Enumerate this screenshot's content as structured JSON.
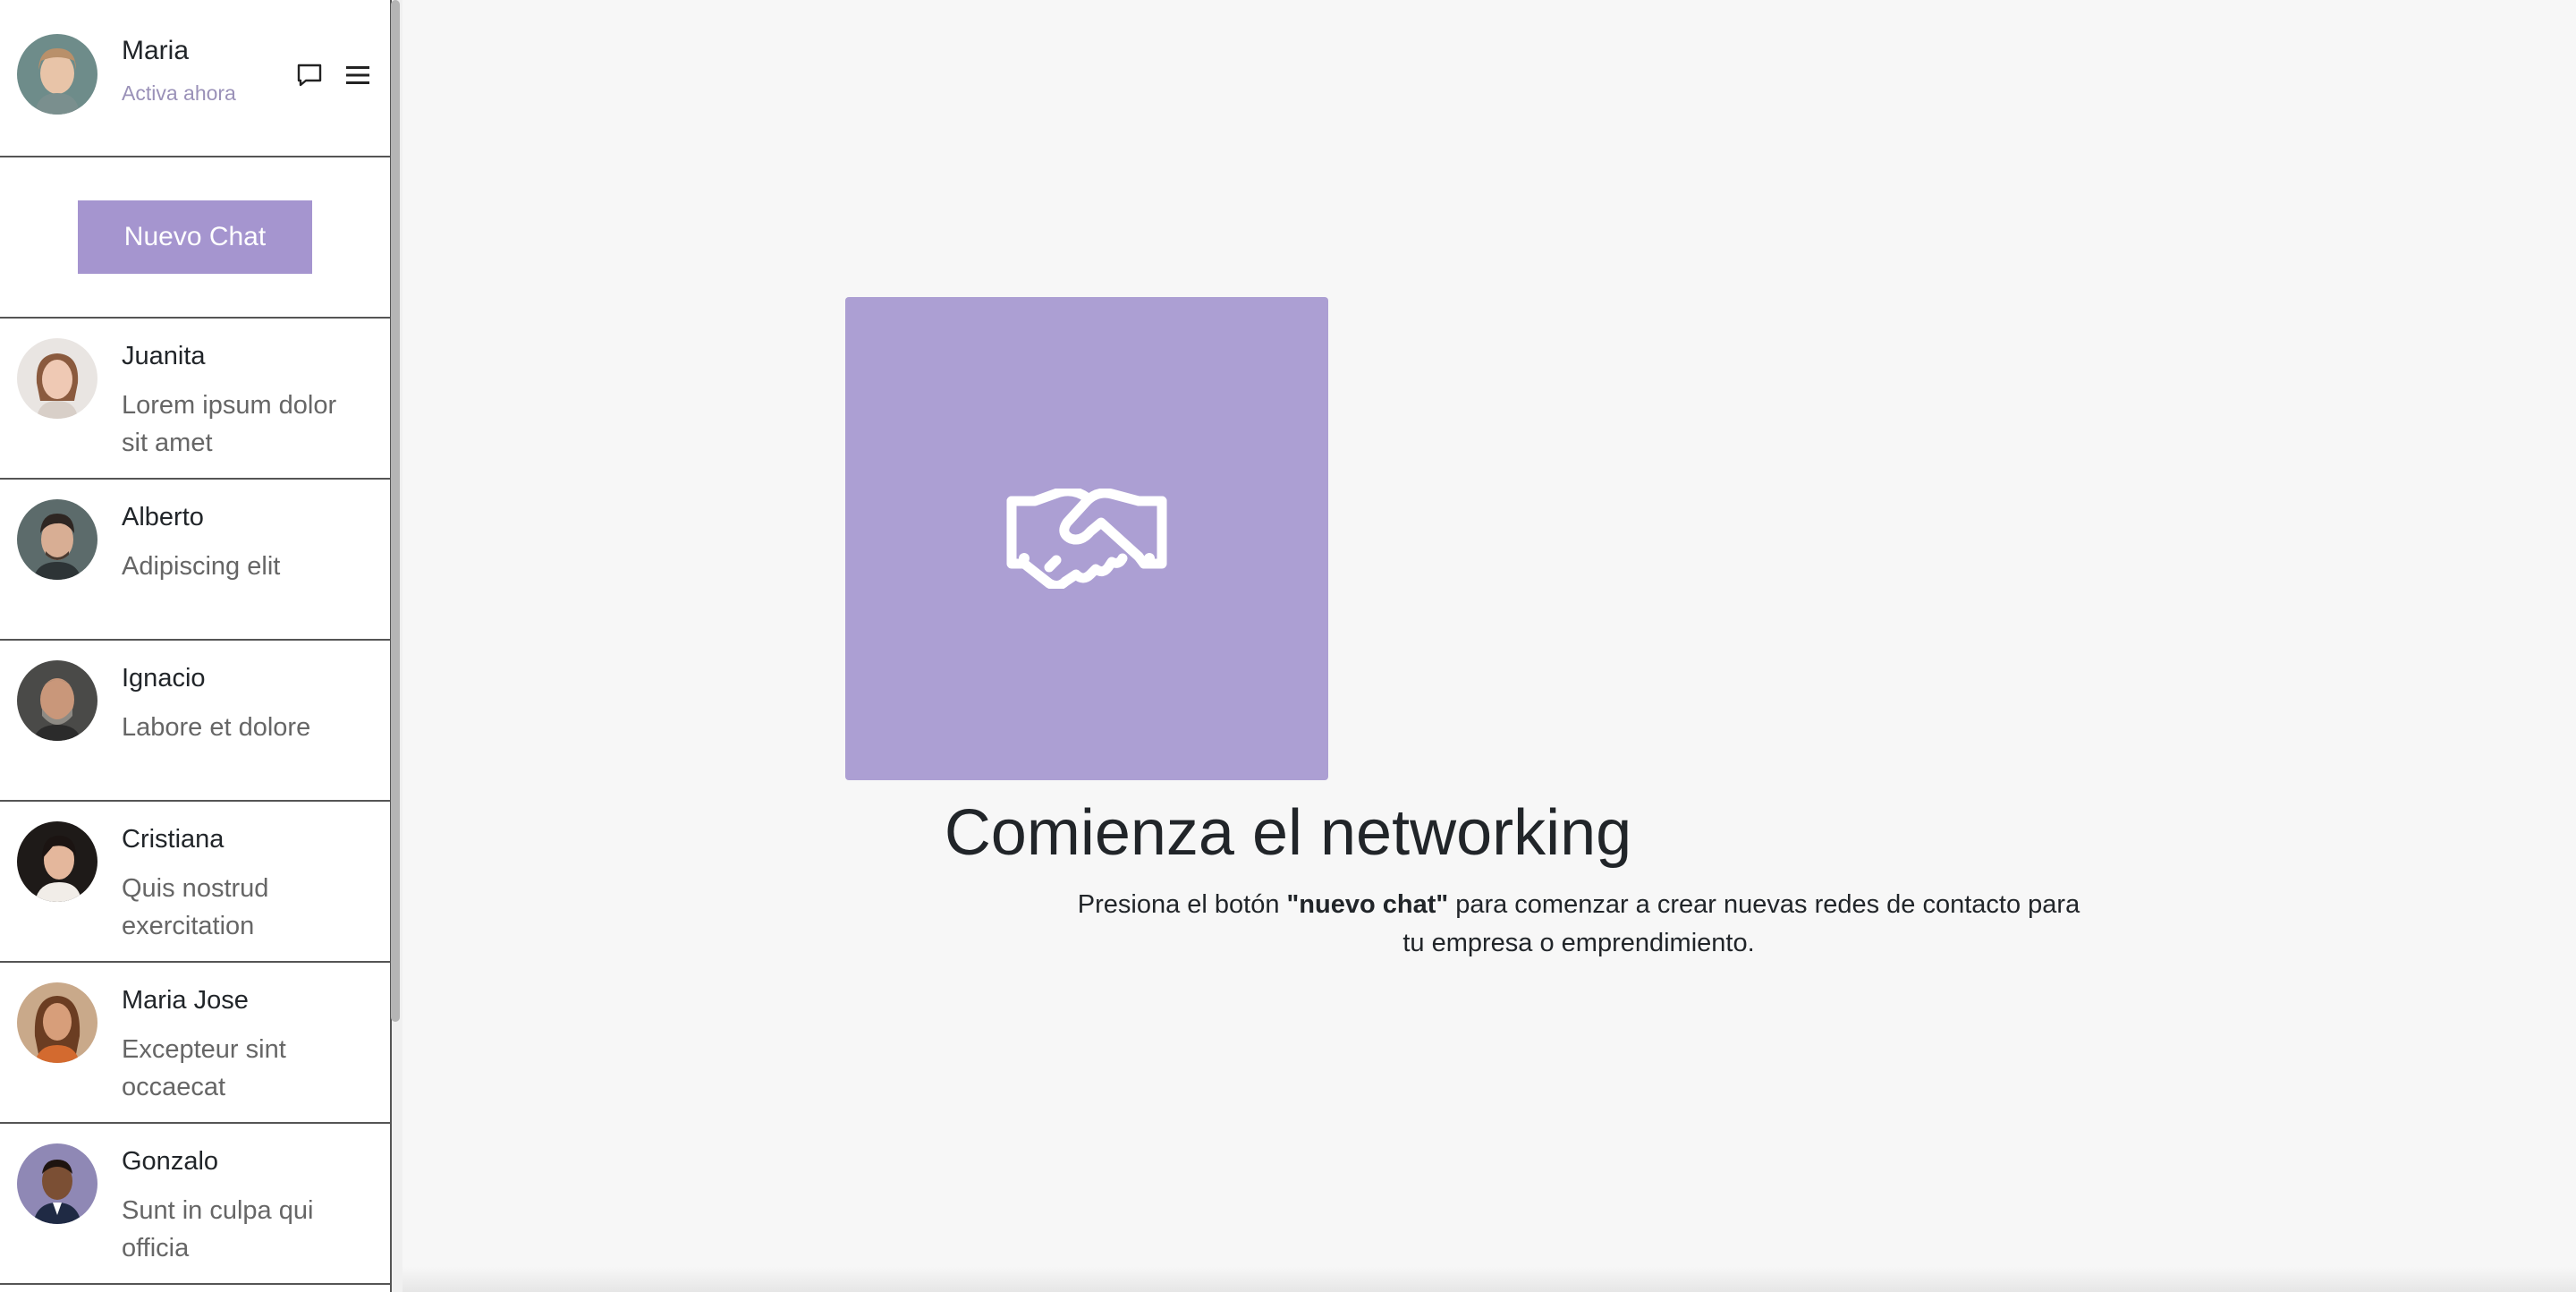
{
  "user": {
    "name": "Maria",
    "status": "Activa ahora"
  },
  "icons": {
    "chat": "chat-bubble-icon",
    "menu": "hamburger-menu-icon",
    "hero": "handshake-icon"
  },
  "new_chat_label": "Nuevo Chat",
  "contacts": [
    {
      "name": "Juanita",
      "message": "Lorem ipsum dolor sit amet"
    },
    {
      "name": "Alberto",
      "message": "Adipiscing elit"
    },
    {
      "name": "Ignacio",
      "message": "Labore et dolore"
    },
    {
      "name": "Cristiana",
      "message": "Quis nostrud exercitation"
    },
    {
      "name": "Maria Jose",
      "message": "Excepteur sint occaecat"
    },
    {
      "name": "Gonzalo",
      "message": "Sunt in culpa qui officia"
    }
  ],
  "main": {
    "title": "Comienza el networking",
    "desc_before": "Presiona el botón ",
    "desc_bold": "\"nuevo chat\"",
    "desc_after": " para comenzar a crear nuevas redes de contacto para tu empresa o emprendimiento."
  },
  "colors": {
    "accent": "#a595cf",
    "hero_bg": "#ac9fd3",
    "status_text": "#9a91b8"
  }
}
